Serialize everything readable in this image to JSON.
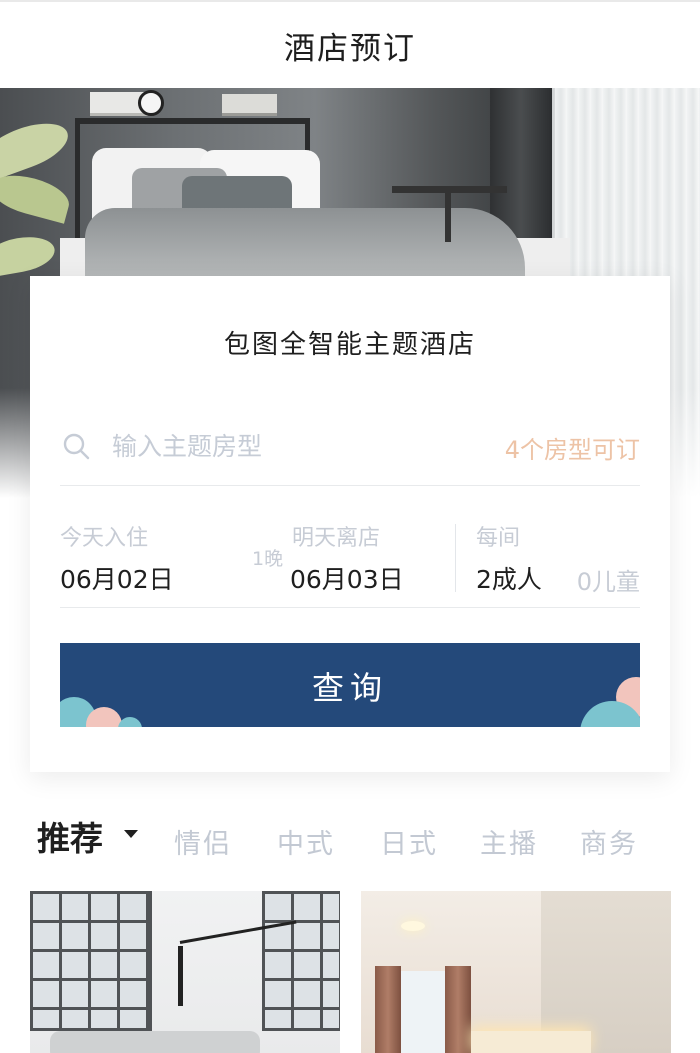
{
  "header": {
    "title": "酒店预订"
  },
  "booking": {
    "hotel_name": "包图全智能主题酒店",
    "search": {
      "placeholder": "输入主题房型",
      "value": "",
      "room_count": "4个房型可订"
    },
    "checkin": {
      "label": "今天入住",
      "date": "06月02日"
    },
    "nights": "1晚",
    "checkout": {
      "label": "明天离店",
      "date": "06月03日"
    },
    "room": {
      "label": "每间",
      "adults": "2成人",
      "children": "0儿童"
    },
    "query_button": "查询"
  },
  "tabs": {
    "active": "推荐",
    "items": [
      "情侣",
      "中式",
      "日式",
      "主播",
      "商务"
    ]
  },
  "colors": {
    "primary": "#24497a",
    "accent_orange": "#edc3a6",
    "muted": "#c7ccd5",
    "bubble_teal": "#7cc4cf",
    "bubble_pink": "#f2c5bd"
  },
  "icons": {
    "search": "search-icon",
    "dropdown": "caret-down-icon"
  }
}
